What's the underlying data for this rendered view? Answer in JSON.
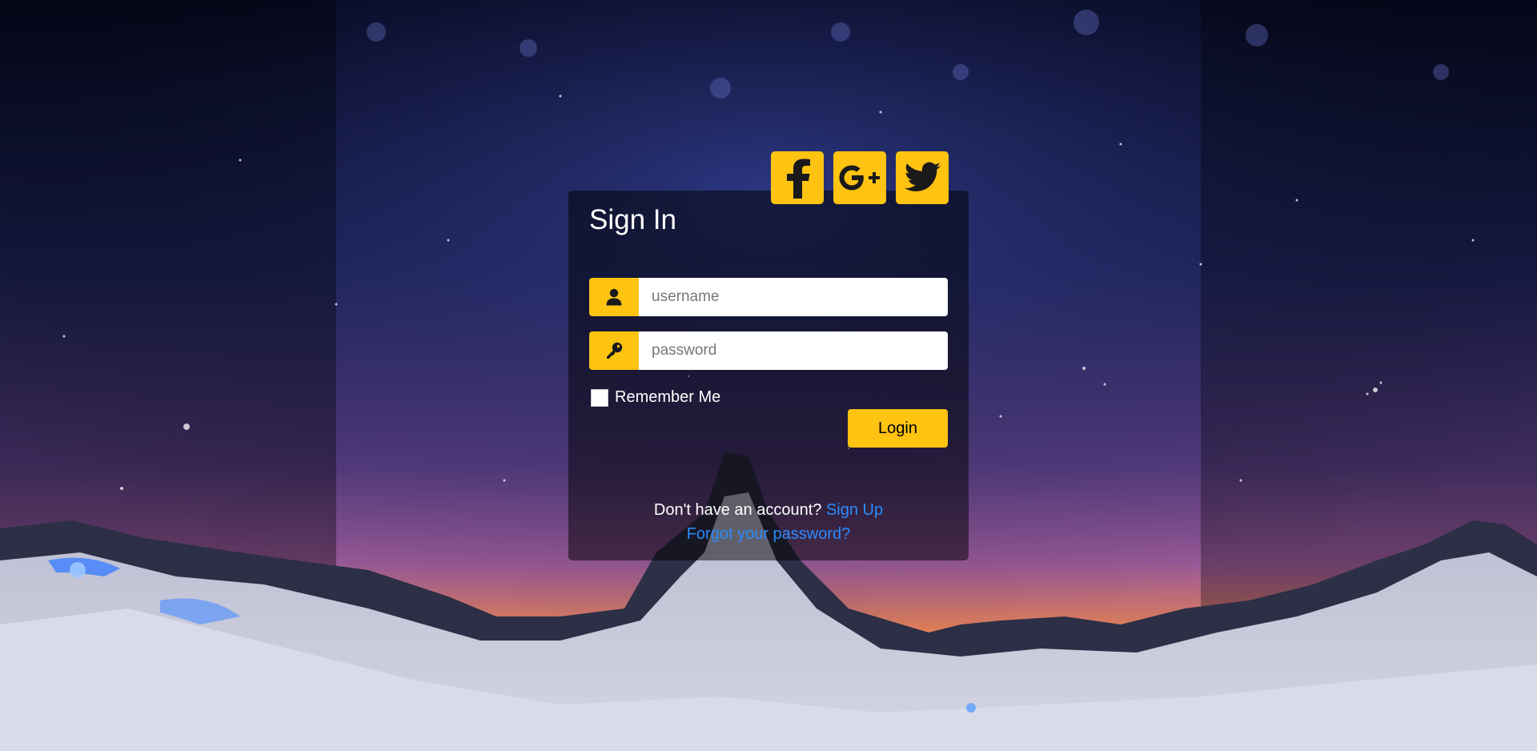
{
  "colors": {
    "accent": "#FFC312",
    "link": "#2b8cff",
    "card_overlay": "rgba(0,0,0,0.5)"
  },
  "social": [
    {
      "name": "facebook",
      "icon": "facebook-icon"
    },
    {
      "name": "google-plus",
      "icon": "google-plus-icon"
    },
    {
      "name": "twitter",
      "icon": "twitter-icon"
    }
  ],
  "form": {
    "title": "Sign In",
    "username": {
      "icon": "user-icon",
      "placeholder": "username",
      "value": ""
    },
    "password": {
      "icon": "key-icon",
      "placeholder": "password",
      "value": ""
    },
    "remember_label": "Remember Me",
    "remember_checked": false,
    "login_label": "Login"
  },
  "footer": {
    "signup_prompt": "Don't have an account? ",
    "signup_link": "Sign Up",
    "forgot_link": "Forgot your password?"
  }
}
